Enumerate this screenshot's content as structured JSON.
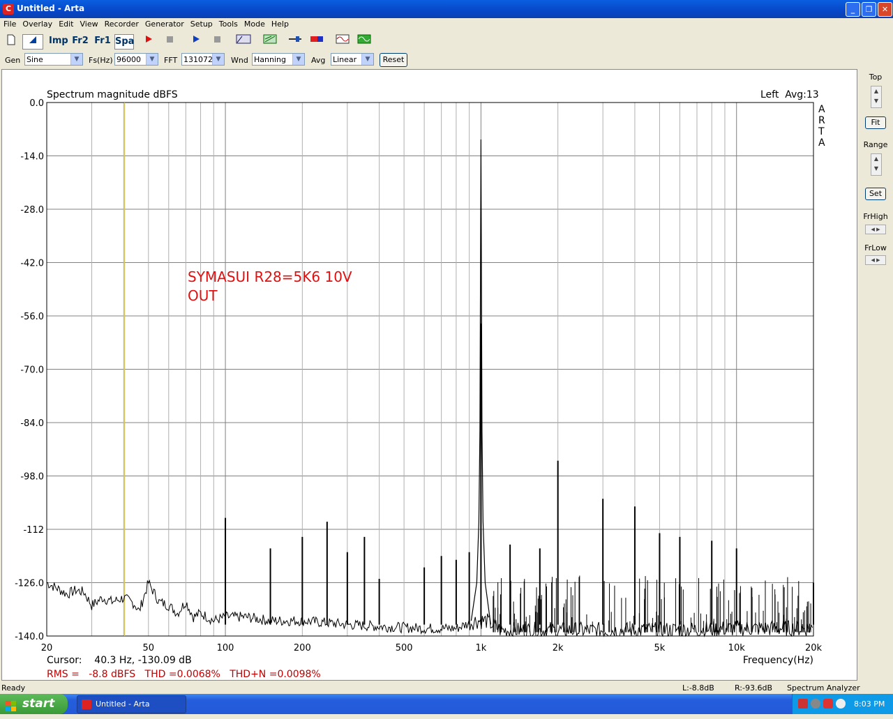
{
  "window": {
    "title": "Untitled - Arta",
    "app_icon": "arta-icon"
  },
  "menu": [
    "File",
    "Overlay",
    "Edit",
    "View",
    "Recorder",
    "Generator",
    "Setup",
    "Tools",
    "Mode",
    "Help"
  ],
  "toolbar": {
    "imp": "Imp",
    "fr2": "Fr2",
    "fr1": "Fr1",
    "spa": "Spa"
  },
  "options": {
    "gen_label": "Gen",
    "gen_value": "Sine",
    "fs_label": "Fs(Hz)",
    "fs_value": "96000",
    "fft_label": "FFT",
    "fft_value": "131072",
    "wnd_label": "Wnd",
    "wnd_value": "Hanning",
    "avg_label": "Avg",
    "avg_value": "Linear",
    "reset_label": "Reset"
  },
  "side": {
    "top_label": "Top",
    "fit_label": "Fit",
    "range_label": "Range",
    "set_label": "Set",
    "frhigh_label": "FrHigh",
    "frlow_label": "FrLow"
  },
  "status": {
    "left": "Ready",
    "l": "L:-8.8dB",
    "r": "R:-93.6dB",
    "mode": "Spectrum Analyzer"
  },
  "taskbar": {
    "start": "start",
    "task": "Untitled - Arta",
    "clock": "8:03 PM"
  },
  "chart_data": {
    "type": "line",
    "title": "Spectrum magnitude dBFS",
    "channel_info": "Left  Avg:13",
    "watermark": "ARTA",
    "xlabel": "Frequency(Hz)",
    "ylabel": "",
    "x_scale": "log",
    "xlim": [
      20,
      20000
    ],
    "ylim": [
      -140,
      0
    ],
    "grid": true,
    "y_ticks": [
      "0.0",
      "-14.0",
      "-28.0",
      "-42.0",
      "-56.0",
      "-70.0",
      "-84.0",
      "-98.0",
      "-112",
      "-126.0",
      "-140.0"
    ],
    "x_ticks": [
      "20",
      "50",
      "100",
      "200",
      "500",
      "1k",
      "2k",
      "5k",
      "10k",
      "20k"
    ],
    "annotation": [
      "SYMASUI R28=5K6 10V",
      "OUT"
    ],
    "cursor_freq_hz": 40.3,
    "cursor_text": "Cursor:    40.3 Hz, -130.09 dB",
    "measurements_text": "RMS =   -8.8 dBFS   THD =0.0068%   THD+N =0.0098%",
    "fundamental": {
      "freq_hz": 1000,
      "level_db": -9.7
    },
    "peaks": [
      {
        "freq_hz": 100,
        "level_db": -109
      },
      {
        "freq_hz": 150,
        "level_db": -117
      },
      {
        "freq_hz": 200,
        "level_db": -114
      },
      {
        "freq_hz": 250,
        "level_db": -110
      },
      {
        "freq_hz": 300,
        "level_db": -118
      },
      {
        "freq_hz": 350,
        "level_db": -114
      },
      {
        "freq_hz": 400,
        "level_db": -125
      },
      {
        "freq_hz": 600,
        "level_db": -122
      },
      {
        "freq_hz": 700,
        "level_db": -119
      },
      {
        "freq_hz": 800,
        "level_db": -120
      },
      {
        "freq_hz": 900,
        "level_db": -118
      },
      {
        "freq_hz": 1000,
        "level_db": -58
      },
      {
        "freq_hz": 1300,
        "level_db": -116
      },
      {
        "freq_hz": 1700,
        "level_db": -117
      },
      {
        "freq_hz": 2000,
        "level_db": -94
      },
      {
        "freq_hz": 3000,
        "level_db": -104
      },
      {
        "freq_hz": 4000,
        "level_db": -106
      },
      {
        "freq_hz": 5000,
        "level_db": -113
      },
      {
        "freq_hz": 6000,
        "level_db": -114
      },
      {
        "freq_hz": 8000,
        "level_db": -115
      },
      {
        "freq_hz": 10000,
        "level_db": -117
      },
      {
        "freq_hz": 20000,
        "level_db": -126
      }
    ],
    "noise_floor": [
      [
        20,
        -126
      ],
      [
        22,
        -127.5
      ],
      [
        24,
        -129
      ],
      [
        26,
        -128
      ],
      [
        28,
        -128.5
      ],
      [
        30,
        -132
      ],
      [
        33,
        -130
      ],
      [
        36,
        -131
      ],
      [
        40,
        -130
      ],
      [
        44,
        -131.5
      ],
      [
        46,
        -133.5
      ],
      [
        50,
        -126
      ],
      [
        55,
        -131
      ],
      [
        60,
        -132
      ],
      [
        65,
        -134
      ],
      [
        70,
        -131
      ],
      [
        75,
        -135
      ],
      [
        80,
        -134
      ],
      [
        90,
        -136
      ],
      [
        100,
        -135
      ],
      [
        120,
        -135
      ],
      [
        150,
        -136
      ],
      [
        200,
        -136
      ],
      [
        300,
        -137
      ],
      [
        400,
        -137.5
      ],
      [
        600,
        -138
      ],
      [
        800,
        -138
      ],
      [
        950,
        -136
      ],
      [
        1050,
        -136
      ],
      [
        1200,
        -138.5
      ],
      [
        2000,
        -138.5
      ],
      [
        5000,
        -138.5
      ],
      [
        10000,
        -138
      ],
      [
        20000,
        -138
      ]
    ]
  }
}
